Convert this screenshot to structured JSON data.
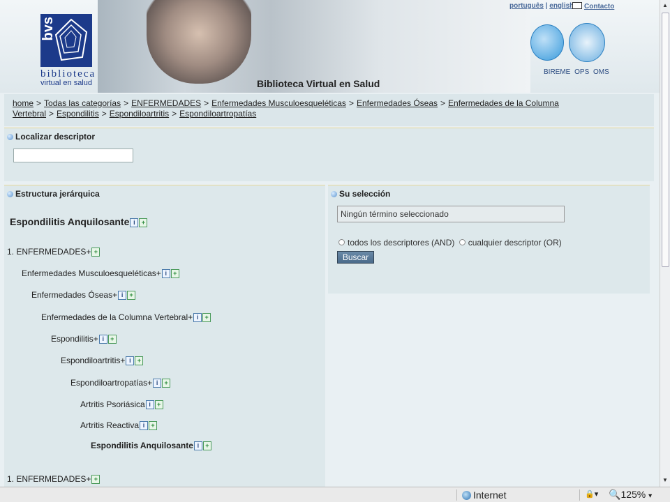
{
  "header": {
    "logo_letters": "bvs",
    "logo_title": "biblioteca",
    "logo_subtitle": "virtual en salud",
    "site_title": "Biblioteca Virtual en Salud",
    "lang_portugues": "português",
    "lang_sep": "|",
    "lang_english": "english",
    "contact": "Contacto",
    "orgs": "BIREME OPS OMS"
  },
  "breadcrumb": [
    "home",
    "Todas las categorías",
    "ENFERMEDADES",
    "Enfermedades Musculoesqueléticas",
    "Enfermedades Óseas",
    "Enfermedades de la Columna Vertebral",
    "Espondilitis",
    "Espondiloartritis",
    "Espondiloartropatías"
  ],
  "breadcrumb_sep": ">",
  "locator": {
    "title": "Localizar descriptor",
    "input_value": ""
  },
  "hierarchy": {
    "title": "Estructura jerárquica",
    "selected_term": "Espondilitis Anquilosante",
    "rows": [
      {
        "label": "1.  ENFERMEDADES+"
      },
      {
        "label": "Enfermedades Musculoesqueléticas+"
      },
      {
        "label": "Enfermedades Óseas+"
      },
      {
        "label": "Enfermedades de la Columna Vertebral+"
      },
      {
        "label": "Espondilitis+"
      },
      {
        "label": "Espondiloartritis+"
      },
      {
        "label": "Espondiloartropatías+"
      },
      {
        "label": "Artritis Psoriásica"
      },
      {
        "label": "Artritis Reactiva"
      },
      {
        "label": "Espondilitis Anquilosante"
      },
      {
        "label": "1.  ENFERMEDADES+"
      }
    ],
    "info_glyph": "i",
    "add_glyph": "+"
  },
  "selection": {
    "title": "Su selección",
    "box_text": "Ningún término seleccionado",
    "radio_and": "todos los descriptores (AND)",
    "radio_or": "cualquier descriptor (OR)",
    "button": "Buscar"
  },
  "statusbar": {
    "zone": "Internet",
    "zoom": "125%"
  }
}
